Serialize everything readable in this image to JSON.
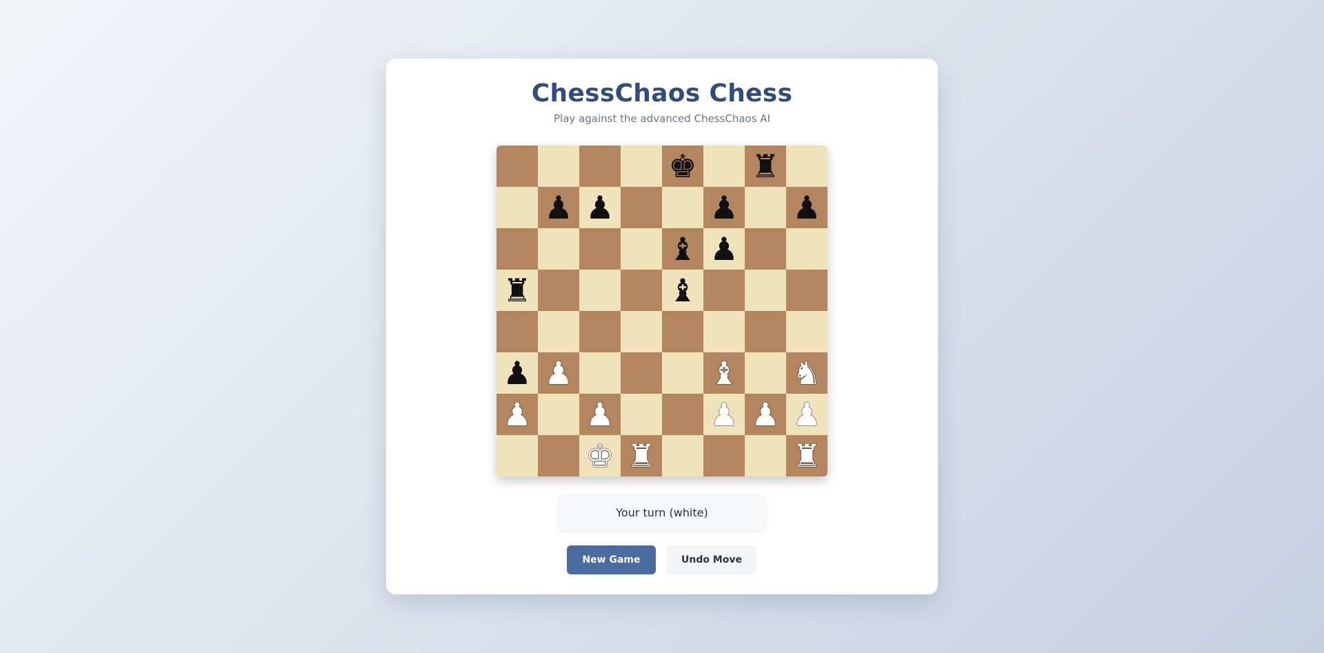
{
  "header": {
    "title": "ChessChaos Chess",
    "subtitle": "Play against the advanced ChessChaos AI"
  },
  "board": {
    "orientation": "white-bottom",
    "colors": {
      "light": "#f0e2bb",
      "dark": "#b38660"
    },
    "ranks": [
      [
        "",
        "",
        "",
        "",
        "bK",
        "",
        "bR",
        ""
      ],
      [
        "",
        "bP",
        "bP",
        "",
        "",
        "bP",
        "",
        "bP"
      ],
      [
        "",
        "",
        "",
        "",
        "bB",
        "bP",
        "",
        ""
      ],
      [
        "bR",
        "",
        "",
        "",
        "bB",
        "",
        "",
        ""
      ],
      [
        "",
        "",
        "",
        "",
        "",
        "",
        "",
        ""
      ],
      [
        "bP",
        "wP",
        "",
        "",
        "",
        "wB",
        "",
        "wN"
      ],
      [
        "wP",
        "",
        "wP",
        "",
        "",
        "wP",
        "wP",
        "wP"
      ],
      [
        "",
        "",
        "wK",
        "wR",
        "",
        "",
        "",
        "wR"
      ]
    ]
  },
  "status": {
    "text": "Your turn (white)"
  },
  "controls": {
    "new_game_label": "New Game",
    "undo_label": "Undo Move"
  },
  "theme": {
    "title_color": "#304d7c",
    "primary_button": "#4a6aa0"
  }
}
